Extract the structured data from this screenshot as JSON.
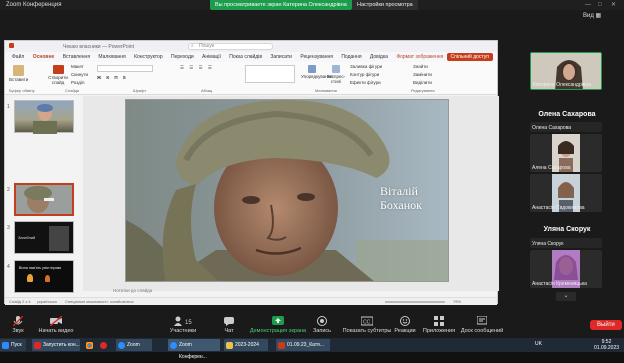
{
  "zoom": {
    "title": "Zoom Конференция",
    "share_banner": "Вы просматриваете экран Катерина Олександрівна",
    "share_settings": "Настройки просмотра",
    "view_label": "Вид",
    "leave_label": "Выйти",
    "colors": {
      "green": "#1e9c4d",
      "red": "#e02828",
      "accent": "#2d8cff"
    }
  },
  "ppt": {
    "window_title": "Чекаю власники — PowerPoint",
    "search_placeholder": "Пошук",
    "tabs": [
      "Файл",
      "Основне",
      "Вставлення",
      "Малювання",
      "Конструктор",
      "Переходи",
      "Анімації",
      "Показ слайдів",
      "Записати",
      "Рецензування",
      "Подання",
      "Довідка",
      "Формат зображення"
    ],
    "access_label": "Спільний доступ",
    "ribbon": {
      "paste": "Вставити",
      "new_slide": "Створити слайд",
      "layout": "Макет",
      "reset": "Скинути",
      "section": "Розділ",
      "groups": [
        "Буфер обміну",
        "Слайди",
        "Шрифт",
        "Абзац",
        "Малювання",
        "Редагування"
      ],
      "arrange": "Упорядкування",
      "quick_styles": "Експрес-стилі",
      "fill": "Заливка фігури",
      "outline": "Контур фігури",
      "effects": "Ефекти фігури",
      "find": "Знайти",
      "replace": "Замінити",
      "select": "Виділити"
    },
    "slide_numbers": [
      "1",
      "2",
      "3",
      "4"
    ],
    "slide_name_line1": "Віталій",
    "slide_name_line2": "Боханок",
    "thumb4_text": "Вічна пам'ять усім героям",
    "thumb3_text": "Загиблий",
    "notes_placeholder": "Нотатки до слайда",
    "status_left": "Слайд 2 з 4",
    "status_lang": "українська",
    "status_access": "Спеціальні можливості: ознайомтеся",
    "zoom_level": "79%"
  },
  "side": {
    "tiles": [
      {
        "name": "Катерина Олександрівна"
      },
      {
        "name": "Олена Сахарова",
        "big": true
      },
      {
        "name": "Алена Сахарова"
      },
      {
        "name": "Анастасія Євдокимова"
      },
      {
        "name": "Уляна Скорук",
        "big": true
      },
      {
        "name": "Анастасія Кременицька"
      }
    ],
    "header1": "Олена Сахарова",
    "header2": "Уляна Скорук"
  },
  "footer": {
    "buttons": [
      {
        "label": "Звук",
        "icon": "mic-icon"
      },
      {
        "label": "Начать видео",
        "icon": "camera-icon"
      },
      {
        "label": "Участники",
        "icon": "participants-icon",
        "count": "15"
      },
      {
        "label": "Чат",
        "icon": "chat-icon"
      },
      {
        "label": "Демонстрация экрана",
        "icon": "share-screen-icon"
      },
      {
        "label": "Запись",
        "icon": "record-icon"
      },
      {
        "label": "Показать субтитры",
        "icon": "captions-icon"
      },
      {
        "label": "Реакции",
        "icon": "reactions-icon"
      },
      {
        "label": "Приложения",
        "icon": "apps-icon"
      },
      {
        "label": "Доск сообщений",
        "icon": "whiteboard-icon"
      }
    ]
  },
  "taskbar": {
    "start": "Пуск",
    "items": [
      "Запустить кон...",
      "Zoom",
      "Zoom Конферен...",
      "2023-2024",
      "01.09.23_Катя..."
    ],
    "lang": "UK",
    "time": "9:52",
    "date": "01.09.2023"
  }
}
